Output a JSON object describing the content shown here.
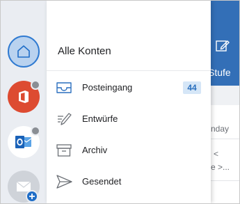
{
  "drawer": {
    "title": "Alle Konten",
    "folders": [
      {
        "label": "Posteingang",
        "icon": "inbox-icon",
        "count": "44"
      },
      {
        "label": "Entwürfe",
        "icon": "drafts-pencil-icon"
      },
      {
        "label": "Archiv",
        "icon": "archive-box-icon"
      },
      {
        "label": "Gesendet",
        "icon": "sent-paper-plane-icon"
      }
    ]
  },
  "accounts": [
    {
      "name": "all-accounts",
      "icon": "home-icon",
      "selected": true
    },
    {
      "name": "office-account",
      "icon": "office-logo-icon"
    },
    {
      "name": "outlook-account",
      "icon": "outlook-logo-icon"
    },
    {
      "name": "add-mail-account",
      "icon": "mail-envelope-icon"
    }
  ],
  "background_app": {
    "header_fragment": "Stufe",
    "fragment_1": "nday",
    "fragment_2": "<",
    "fragment_3": "e >..."
  },
  "colors": {
    "accent": "#2f7ad1",
    "header_blue": "#336fb7",
    "office_red": "#dd4b31",
    "rail_bg": "#eaedf2",
    "badge_bg": "#d5e6f7"
  }
}
